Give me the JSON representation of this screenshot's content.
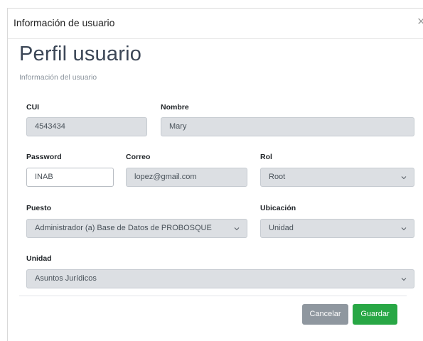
{
  "modal": {
    "title": "Información de usuario",
    "close": "×"
  },
  "profile": {
    "heading": "Perfil usuario",
    "subheading": "Información del usuario"
  },
  "fields": {
    "cui": {
      "label": "CUI",
      "value": "4543434"
    },
    "nombre": {
      "label": "Nombre",
      "value": "Mary"
    },
    "password": {
      "label": "Password",
      "value": "INAB"
    },
    "correo": {
      "label": "Correo",
      "value": "lopez@gmail.com"
    },
    "rol": {
      "label": "Rol",
      "value": "Root"
    },
    "puesto": {
      "label": "Puesto",
      "value": "Administrador (a) Base de Datos de PROBOSQUE"
    },
    "ubicacion": {
      "label": "Ubicación",
      "value": "Unidad"
    },
    "unidad": {
      "label": "Unidad",
      "value": "Asuntos Jurídicos"
    }
  },
  "buttons": {
    "cancel": "Cancelar",
    "save": "Guardar"
  },
  "colors": {
    "save": "#28a745",
    "cancel": "#8f979f",
    "disabled_field": "#dcdfe3"
  },
  "icons": {
    "close": "close-icon",
    "select_arrow": "chevron-down-icon"
  }
}
